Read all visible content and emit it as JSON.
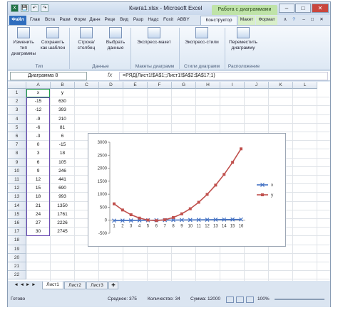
{
  "window": {
    "title": "Книга1.xlsx - Microsoft Excel",
    "context_header": "Работа с диаграммами",
    "min": "–",
    "max": "□",
    "close": "✕"
  },
  "qat": [
    "💾",
    "↶",
    "↷"
  ],
  "tabs": [
    "Файл",
    "Глав",
    "Вста",
    "Разм",
    "Форм",
    "Данн",
    "Реце",
    "Вид",
    "Разр",
    "Надс",
    "Foxit",
    "ABBY",
    "Конструктор",
    "Макет",
    "Формат"
  ],
  "ribbon": {
    "buttons": [
      "Изменить тип диаграммы",
      "Сохранить как шаблон",
      "Строка/столбец",
      "Выбрать данные",
      "Экспресс-макет",
      "Экспресс-стили",
      "Переместить диаграмму"
    ],
    "groups": [
      "Тип",
      "Данные",
      "Макеты диаграмм",
      "Стили диаграмм",
      "Расположение"
    ]
  },
  "formula_bar": {
    "name_box": "Диаграмма 8",
    "fx": "fx",
    "formula": "=РЯД(Лист1!$A$1;;Лист1!$A$2:$A$17;1)"
  },
  "columns": [
    "A",
    "B",
    "C",
    "D",
    "E",
    "F",
    "G",
    "H",
    "I",
    "J",
    "K",
    "L"
  ],
  "rows": [
    "1",
    "2",
    "3",
    "4",
    "5",
    "6",
    "7",
    "8",
    "9",
    "10",
    "11",
    "12",
    "13",
    "14",
    "15",
    "16",
    "17",
    "18",
    "19",
    "20",
    "21",
    "22"
  ],
  "table": {
    "headers": [
      "x",
      "y"
    ],
    "data": [
      [
        "-15",
        "630"
      ],
      [
        "-12",
        "393"
      ],
      [
        "-9",
        "210"
      ],
      [
        "-6",
        "81"
      ],
      [
        "-3",
        "6"
      ],
      [
        "0",
        "-15"
      ],
      [
        "3",
        "18"
      ],
      [
        "6",
        "105"
      ],
      [
        "9",
        "246"
      ],
      [
        "12",
        "441"
      ],
      [
        "15",
        "690"
      ],
      [
        "18",
        "993"
      ],
      [
        "21",
        "1350"
      ],
      [
        "24",
        "1761"
      ],
      [
        "27",
        "2226"
      ],
      [
        "30",
        "2745"
      ]
    ]
  },
  "chart_data": {
    "type": "line",
    "categories": [
      "1",
      "2",
      "3",
      "4",
      "5",
      "6",
      "7",
      "8",
      "9",
      "10",
      "11",
      "12",
      "13",
      "14",
      "15",
      "16"
    ],
    "series": [
      {
        "name": "x",
        "values": [
          -15,
          -12,
          -9,
          -6,
          -3,
          0,
          3,
          6,
          9,
          12,
          15,
          18,
          21,
          24,
          27,
          30
        ],
        "color": "#4472c4",
        "marker": "x"
      },
      {
        "name": "y",
        "values": [
          630,
          393,
          210,
          81,
          6,
          -15,
          18,
          105,
          246,
          441,
          690,
          993,
          1350,
          1761,
          2226,
          2745
        ],
        "color": "#c0504d",
        "marker": "square"
      }
    ],
    "yticks": [
      "3000",
      "2500",
      "2000",
      "1500",
      "1000",
      "500",
      "0",
      "-500"
    ],
    "ylim": [
      -500,
      3000
    ],
    "grid": false,
    "legend": "right"
  },
  "sheets": [
    "Лист1",
    "Лист2",
    "Лист3"
  ],
  "status": {
    "ready": "Готово",
    "average": "Среднее: 375",
    "count": "Количество: 34",
    "sum": "Сумма: 12000",
    "zoom": "100%"
  }
}
